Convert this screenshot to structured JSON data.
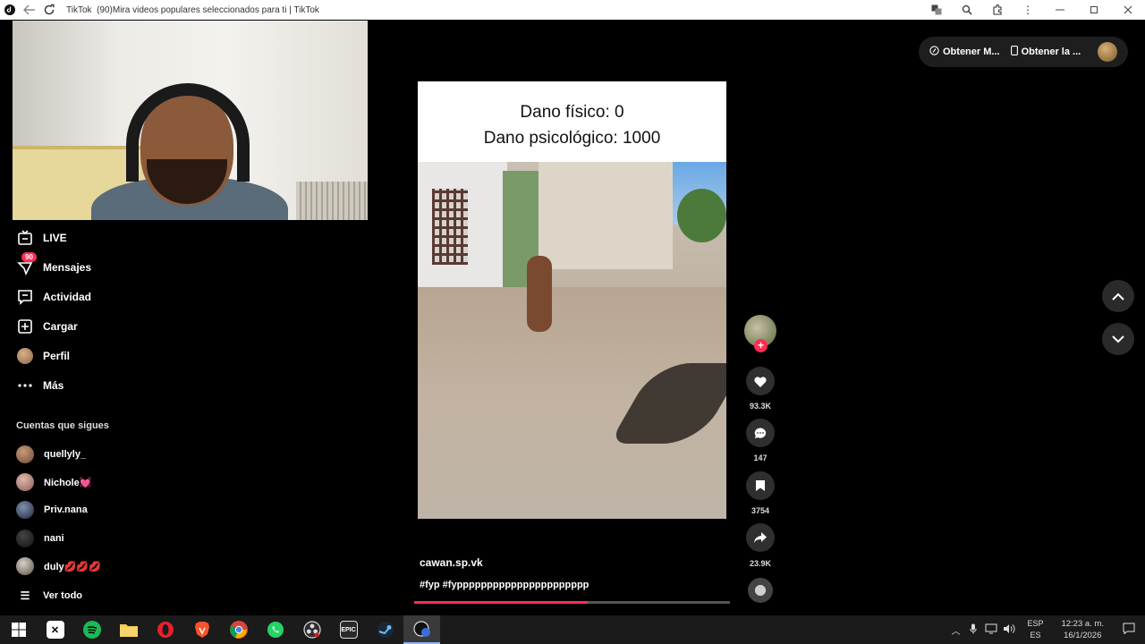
{
  "titlebar": {
    "app_name": "TikTok",
    "page_title": "(90)Mira videos populares seleccionados para ti | TikTok",
    "icons": [
      "back-arrow-icon",
      "reload-icon",
      "translate-icon",
      "zoom-icon",
      "extensions-icon",
      "more-icon",
      "minimize-icon",
      "maximize-icon",
      "close-icon"
    ]
  },
  "sidebar": {
    "nav": [
      {
        "label": "LIVE",
        "icon": "live-tv-icon"
      },
      {
        "label": "Mensajes",
        "icon": "inbox-icon",
        "badge": "90"
      },
      {
        "label": "Actividad",
        "icon": "activity-icon"
      },
      {
        "label": "Cargar",
        "icon": "upload-plus-icon"
      },
      {
        "label": "Perfil",
        "icon": "profile-avatar"
      },
      {
        "label": "Más",
        "icon": "more-dots-icon"
      }
    ],
    "following_title": "Cuentas que sigues",
    "following": [
      {
        "name": "quellyly_"
      },
      {
        "name": "Nichole💓"
      },
      {
        "name": "Priv.nana"
      },
      {
        "name": "nani"
      },
      {
        "name": "duly💋💋💋"
      }
    ],
    "see_all": "Ver todo"
  },
  "video": {
    "caption_line1": "Dano físico: 0",
    "caption_line2": "Dano psicológico: 1000",
    "author": "cawan.sp.vk",
    "hashtags": "#fyp #fypppppppppppppppppppppp",
    "progress_fraction": 0.55
  },
  "actions": {
    "likes": "93.3K",
    "comments": "147",
    "saves": "3754",
    "shares": "23.9K"
  },
  "topright": {
    "btn1_label": "Obtener M...",
    "btn2_label": "Obtener la ..."
  },
  "taskbar": {
    "apps": [
      "windows-start-icon",
      "capcut-icon",
      "spotify-icon",
      "file-explorer-icon",
      "opera-icon",
      "brave-icon",
      "chrome-icon",
      "whatsapp-icon",
      "obs-icon",
      "epic-games-icon",
      "steam-icon",
      "active-app-icon"
    ],
    "lang_top": "ESP",
    "lang_bottom": "ES",
    "time": "12:23 a. m.",
    "date": "16/1/2026"
  },
  "colors": {
    "accent": "#fe2c55",
    "background": "#000000",
    "panel": "#1e1e1e"
  }
}
